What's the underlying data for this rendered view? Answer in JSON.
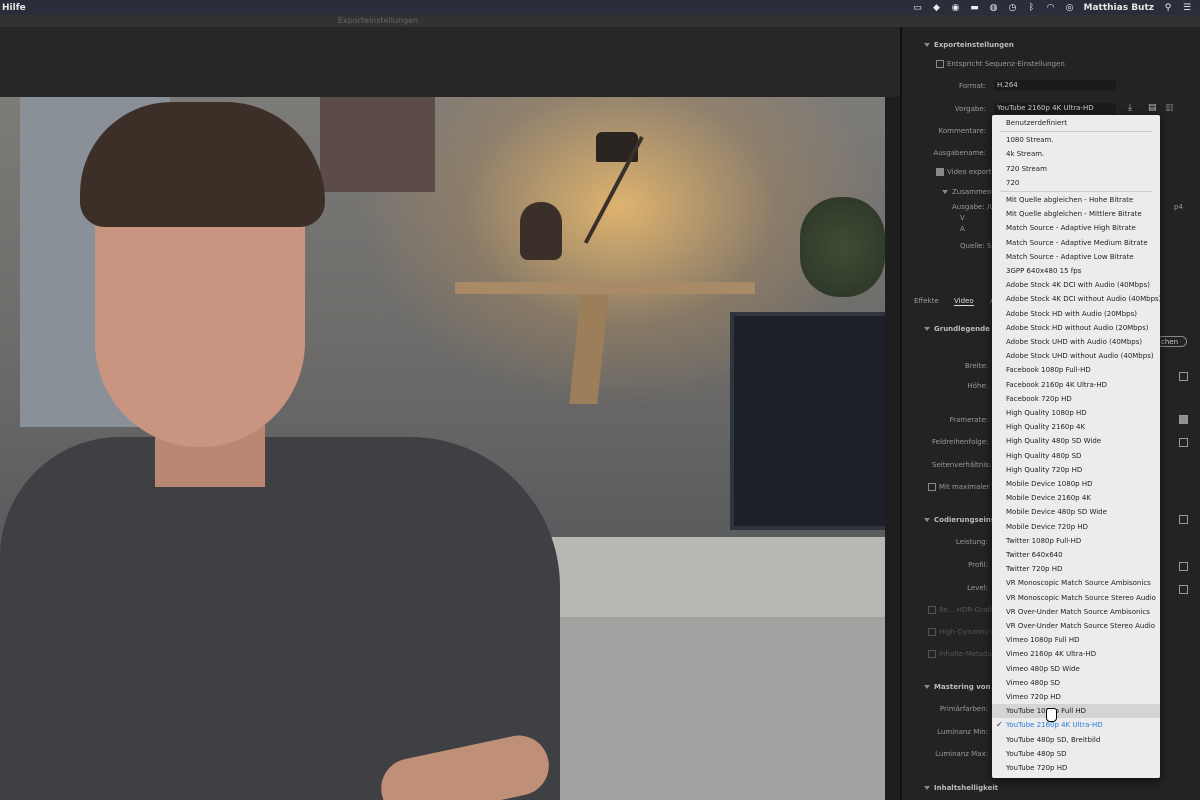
{
  "menubar": {
    "app_menu": "Hilfe",
    "user": "Matthias Butz",
    "tray_icons": [
      "screen-icon",
      "dropbox-icon",
      "browser-icon",
      "display-icon",
      "vpn-icon",
      "time-machine-icon",
      "bluetooth-icon",
      "wifi-icon",
      "user-icon",
      "search-icon",
      "menu-icon"
    ]
  },
  "window": {
    "title": "Exporteinstellungen"
  },
  "export": {
    "section_title": "Exporteinstellungen",
    "match_sequence_label": "Entspricht Sequenz-Einstellungen",
    "format_label": "Format:",
    "format_value": "H.264",
    "preset_label": "Vorgabe:",
    "preset_value": "YouTube 2160p 4K Ultra-HD",
    "comments_label": "Kommentare:",
    "output_name_label": "Ausgabename:",
    "export_video_label": "Video exportieren",
    "summary_label": "Zusammenf",
    "output_label": "Ausgabe: /U",
    "source_label": "Quelle: Se",
    "tabs": [
      "Effekte",
      "Video",
      "A"
    ],
    "basic_video_label": "Grundlegende Vi",
    "width_label": "Breite:",
    "height_label": "Höhe:",
    "framerate_label": "Framerate:",
    "field_order_label": "Feldreihenfolge:",
    "aspect_label": "Seitenverhältnis:",
    "max_depth_label": "Mit maximaler Ti",
    "encoding_label": "Codierungseinste",
    "performance_label": "Leistung:",
    "profile_label": "Profil:",
    "level_label": "Level:",
    "hdr_label_1": "Re... HDR-Grafikw",
    "hdr_label_2": "High-Dynamic-Ra",
    "hdr_label_3": "Inhalte-Metadat",
    "mastering_label": "Mastering von Ar",
    "primaries_label": "Primärfarben:",
    "lum_min_label": "Luminanz Min:",
    "lum_max_label": "Luminanz Max:",
    "content_brightness_label": "Inhaltshelligkeit",
    "side_fragment_1": "p4",
    "side_fragment_2": "chen"
  },
  "dropdown": {
    "items": [
      "Benutzerdefiniert",
      "1080 Stream.",
      "4k Stream.",
      "720 Stream",
      "720",
      "Mit Quelle abgleichen - Hohe Bitrate",
      "Mit Quelle abgleichen - Mittlere Bitrate",
      "Match Source - Adaptive High Bitrate",
      "Match Source - Adaptive Medium Bitrate",
      "Match Source - Adaptive Low Bitrate",
      "3GPP 640x480 15 fps",
      "Adobe Stock 4K DCI with Audio (40Mbps)",
      "Adobe Stock 4K DCI without Audio (40Mbps)",
      "Adobe Stock HD with Audio (20Mbps)",
      "Adobe Stock HD without Audio (20Mbps)",
      "Adobe Stock UHD with Audio (40Mbps)",
      "Adobe Stock UHD without Audio (40Mbps)",
      "Facebook 1080p Full-HD",
      "Facebook 2160p 4K Ultra-HD",
      "Facebook 720p HD",
      "High Quality 1080p HD",
      "High Quality 2160p 4K",
      "High Quality 480p SD Wide",
      "High Quality 480p SD",
      "High Quality 720p HD",
      "Mobile Device 1080p HD",
      "Mobile Device 2160p 4K",
      "Mobile Device 480p SD Wide",
      "Mobile Device 720p HD",
      "Twitter 1080p Full-HD",
      "Twitter 640x640",
      "Twitter 720p HD",
      "VR Monoscopic Match Source Ambisonics",
      "VR Monoscopic Match Source Stereo Audio",
      "VR Over-Under Match Source Ambisonics",
      "VR Over-Under Match Source Stereo Audio",
      "Vimeo 1080p Full HD",
      "Vimeo 2160p 4K Ultra-HD",
      "Vimeo 480p SD Wide",
      "Vimeo 480p SD",
      "Vimeo 720p HD",
      "YouTube 1080p Full HD",
      "YouTube 2160p 4K Ultra-HD",
      "YouTube 480p SD, Breitbild",
      "YouTube 480p SD",
      "YouTube 720p HD"
    ],
    "hover_index": 41,
    "selected_index": 42,
    "check_mark": "✓"
  },
  "colors": {
    "selected": "#2a7de1",
    "panel": "#232323"
  }
}
